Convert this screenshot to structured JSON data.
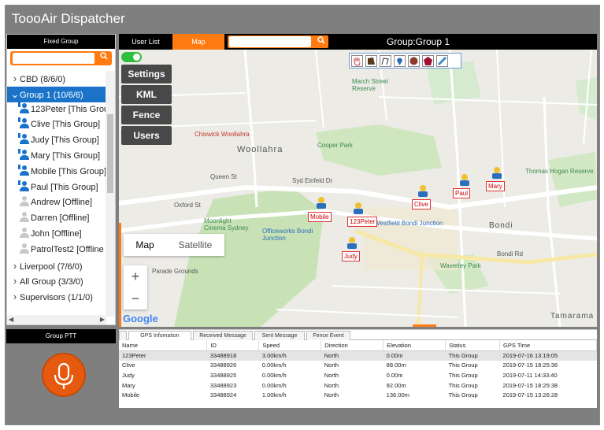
{
  "app": {
    "title": "ToooAir Dispatcher"
  },
  "left": {
    "fixed_group_label": "Fixed Group",
    "search_placeholder": "",
    "tree": [
      {
        "label": "CBD (8/6/0)",
        "type": "group"
      },
      {
        "label": "Group 1 (10/6/6)",
        "type": "group",
        "selected": true
      },
      {
        "label": "123Peter [This Grou",
        "type": "online"
      },
      {
        "label": "Clive [This Group]",
        "type": "online"
      },
      {
        "label": "Judy [This Group]",
        "type": "online"
      },
      {
        "label": "Mary [This Group]",
        "type": "online"
      },
      {
        "label": "Mobile [This Group]",
        "type": "online"
      },
      {
        "label": "Paul [This Group]",
        "type": "online"
      },
      {
        "label": "Andrew [Offline]",
        "type": "offline"
      },
      {
        "label": "Darren [Offline]",
        "type": "offline"
      },
      {
        "label": "John [Offline]",
        "type": "offline"
      },
      {
        "label": "PatrolTest2 [Offline",
        "type": "offline"
      },
      {
        "label": "Liverpool (7/6/0)",
        "type": "group"
      },
      {
        "label": "All Group (3/3/0)",
        "type": "group"
      },
      {
        "label": "Supervisors (1/1/0)",
        "type": "group"
      }
    ],
    "group_ptt_label": "Group PTT"
  },
  "top": {
    "tabs": [
      {
        "label": "User List",
        "active": false
      },
      {
        "label": "Map",
        "active": true
      }
    ],
    "map_search_placeholder": "",
    "group_title": "Group:Group 1"
  },
  "map": {
    "side_menu": [
      "Settings",
      "KML",
      "Fence",
      "Users"
    ],
    "map_type": [
      "Map",
      "Satellite"
    ],
    "zoom_in": "+",
    "zoom_out": "−",
    "google": "Google",
    "places": [
      {
        "t": "Woollahra",
        "c": "map"
      },
      {
        "t": "Cooper Park",
        "c": "green"
      },
      {
        "t": "March Street Reserve",
        "c": "green"
      },
      {
        "t": "Thomas Hogan Reserve",
        "c": "green"
      },
      {
        "t": "Chiswick Woollahra",
        "c": "map"
      },
      {
        "t": "Officeworks Bondi Junction",
        "c": "blue"
      },
      {
        "t": "Westfield Bondi Junction",
        "c": "blue"
      },
      {
        "t": "Moonlight Cinema Sydney",
        "c": "green"
      },
      {
        "t": "Waverley Park",
        "c": "green"
      },
      {
        "t": "Bondi",
        "c": "map"
      },
      {
        "t": "Tamarama",
        "c": "map"
      },
      {
        "t": "Oxford St",
        "c": "map"
      },
      {
        "t": "Syd Einfeld Dr",
        "c": "map"
      },
      {
        "t": "Parade Grounds",
        "c": "map"
      },
      {
        "t": "Queen St",
        "c": "map"
      },
      {
        "t": "Bondi Rd",
        "c": "map"
      }
    ],
    "users": [
      {
        "name": "Mobile"
      },
      {
        "name": "123Peter"
      },
      {
        "name": "Judy"
      },
      {
        "name": "Clive"
      },
      {
        "name": "Paul"
      },
      {
        "name": "Mary"
      }
    ]
  },
  "bottom": {
    "tabs": [
      "GPS Infomation",
      "Received Message",
      "Sent Message",
      "Fence Event"
    ],
    "columns": [
      "Name",
      "ID",
      "Speed",
      "Direction",
      "Elevation",
      "Status",
      "GPS Time"
    ],
    "rows": [
      [
        "123Peter",
        "33488918",
        "3.00km/h",
        "North",
        "0.00m",
        "This Group",
        "2019-07-16 13:19:05"
      ],
      [
        "Clive",
        "33488926",
        "0.00km/h",
        "North",
        "88.00m",
        "This Group",
        "2019-07-15 18:25:36"
      ],
      [
        "Judy",
        "33488925",
        "0.00km/h",
        "North",
        "0.00m",
        "This Group",
        "2019-07-11 14:33:40"
      ],
      [
        "Mary",
        "33488923",
        "0.00km/h",
        "North",
        "92.00m",
        "This Group",
        "2019-07-15 18:25:38"
      ],
      [
        "Mobile",
        "33488924",
        "1.00km/h",
        "North",
        "136.00m",
        "This Group",
        "2019-07-15 13:26:28"
      ]
    ]
  },
  "colors": {
    "accent": "#ff7a10",
    "select": "#1a73c8",
    "ptt": "#e65a10"
  }
}
